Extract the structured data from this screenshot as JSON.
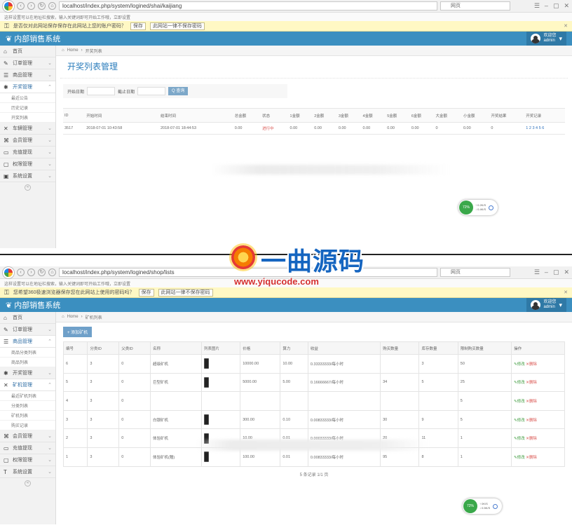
{
  "shot_a": {
    "browser": {
      "url": "localhost/index.php/system/logined/shai/kaijiang",
      "search_placeholder": "网页",
      "tab_text": "这样设置可以在地址栏搜索，输入关键词即可开始工作哦，立即设置"
    },
    "notice": {
      "text": "是否仅对此网站保存保存在此网站上您的账户密码？",
      "save_label": "保存",
      "never_label": "此网站一律不保存密码"
    },
    "app": {
      "brand": "内部销售系统",
      "user_name": "欢迎您",
      "user_role": "admin"
    },
    "sidebar": {
      "items": [
        {
          "icon": "⌂",
          "label": "首页"
        },
        {
          "icon": "✎",
          "label": "订单管理"
        },
        {
          "icon": "☰",
          "label": "商品管理"
        },
        {
          "icon": "✱",
          "label": "开奖管理",
          "active": true
        }
      ],
      "subitems": [
        "最近公告",
        "历史记录",
        "开奖列表"
      ],
      "items_after": [
        {
          "icon": "✕",
          "label": "车辆管理"
        },
        {
          "icon": "⌘",
          "label": "会员管理"
        },
        {
          "icon": "▭",
          "label": "充值提现"
        },
        {
          "icon": "▢",
          "label": "权限管理"
        },
        {
          "icon": "▣",
          "label": "系统设置"
        }
      ]
    },
    "breadcrumb": {
      "home": "Home",
      "current": "开奖列表"
    },
    "page_title": "开奖列表管理",
    "filter": {
      "start_label": "开始日期",
      "end_label": "截止日期",
      "query_label": "Q 查询"
    },
    "table": {
      "headers": [
        "ID",
        "开始时间",
        "结束时间",
        "总金额",
        "状态",
        "1金额",
        "2金额",
        "3金额",
        "4金额",
        "5金额",
        "6金额",
        "大金额",
        "小金额",
        "开奖结果",
        "开奖记录"
      ],
      "rows": [
        [
          "3517",
          "2018-07-01 10:43:58",
          "2018-07-01 18:44:53",
          "0.00",
          "进行中",
          "0.00",
          "0.00",
          "0.00",
          "0.00",
          "0.00",
          "0.00",
          "0",
          "0.00",
          "0",
          "1 2 3 4 5 6"
        ]
      ]
    },
    "widget": {
      "percent": "72%",
      "line1": "↑ 0.2K/S",
      "line2": "↓ 0.4K/S"
    }
  },
  "shot_b": {
    "browser": {
      "url": "localhost/index.php/system/logined/shop/lists",
      "search_placeholder": "网页",
      "tab_text": "这样设置可以在地址栏搜索，输入关键词即可开始工作哦，立即设置"
    },
    "notice": {
      "text": "您希望360极速浏览器保存您在此网站上使用的密码吗？",
      "save_label": "保存",
      "never_label": "此网站一律不保存密码"
    },
    "app": {
      "brand": "内部销售系统",
      "user_name": "欢迎您",
      "user_role": "admin"
    },
    "sidebar": {
      "items": [
        {
          "icon": "⌂",
          "label": "首页"
        },
        {
          "icon": "✎",
          "label": "订单管理"
        },
        {
          "icon": "☰",
          "label": "商品管理",
          "active": true
        }
      ],
      "subitems_1": [
        "商品分类列表",
        "商品列表"
      ],
      "items_mid": [
        {
          "icon": "✱",
          "label": "开奖管理"
        },
        {
          "icon": "✕",
          "label": "矿机管理",
          "active": true
        }
      ],
      "subitems_2": [
        "最近矿机列表",
        "分类列表",
        "矿机列表",
        "购买记录"
      ],
      "items_after": [
        {
          "icon": "⌘",
          "label": "会员管理"
        },
        {
          "icon": "▭",
          "label": "充值提现"
        },
        {
          "icon": "▢",
          "label": "权限管理"
        },
        {
          "icon": "T",
          "label": "系统设置"
        }
      ]
    },
    "breadcrumb": {
      "home": "Home",
      "current": "矿机列表"
    },
    "add_label": "+ 添加矿机",
    "table": {
      "headers": [
        "编号",
        "分类ID",
        "父类ID",
        "名称",
        "列表图片",
        "价格",
        "算力",
        "收益",
        "购买数量",
        "库存数量",
        "限制购买数量",
        "操作"
      ],
      "rows": [
        [
          "6",
          "3",
          "0",
          "超级矿机",
          "10000.00",
          "10.00",
          "0.33333333/每小时",
          "",
          "3",
          "50"
        ],
        [
          "5",
          "3",
          "0",
          "巨型矿机",
          "5000.00",
          "5.00",
          "0.16666667/每小时",
          "34",
          "5",
          "25"
        ],
        [
          "4",
          "3",
          "0",
          "",
          "",
          "",
          "",
          "",
          "",
          "5"
        ],
        [
          "3",
          "3",
          "0",
          "白银矿机",
          "300.00",
          "0.10",
          "0.00833333/每小时",
          "30",
          "9",
          "5"
        ],
        [
          "2",
          "3",
          "0",
          "体验矿机",
          "10.00",
          "0.01",
          "0.00033333/每小时",
          "20",
          "11",
          "1"
        ],
        [
          "1",
          "3",
          "0",
          "体验矿机(赠)",
          "100.00",
          "0.01",
          "0.00833333/每小时",
          "95",
          "8",
          "1"
        ]
      ],
      "edit_label": "✎修改",
      "delete_label": "✕删除"
    },
    "pager": "5 条记录 1/1 页",
    "widget": {
      "percent": "72%",
      "line1": "↑ 0K/S",
      "line2": "↓ 0.5K/S"
    }
  },
  "watermark": {
    "title": "一曲源码",
    "url": "www.yiqucode.com"
  }
}
